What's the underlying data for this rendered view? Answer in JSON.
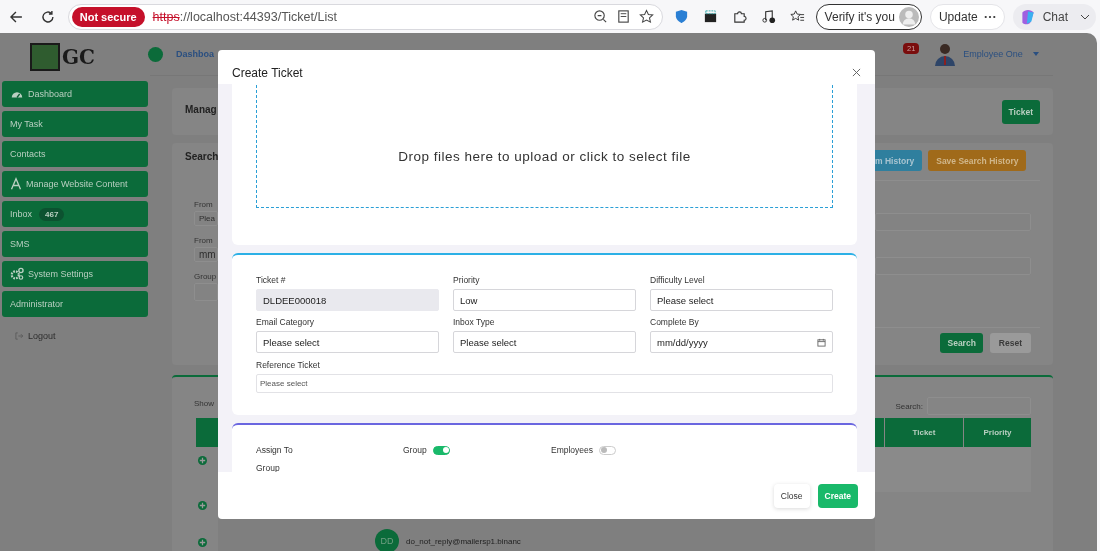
{
  "browser": {
    "security": "Not secure",
    "url_scheme": "https",
    "url_rest": "://localhost:44393/Ticket/List",
    "verify": "Verify it's you",
    "update": "Update",
    "chat": "Chat"
  },
  "sidebar": {
    "logo_text": "GC",
    "items": [
      {
        "label": "Dashboard"
      },
      {
        "label": "My Task"
      },
      {
        "label": "Contacts"
      },
      {
        "label": "Manage Website Content"
      },
      {
        "label": "Inbox",
        "badge": "467"
      },
      {
        "label": "SMS"
      },
      {
        "label": "System Settings"
      },
      {
        "label": "Administrator"
      }
    ],
    "logout": "Logout"
  },
  "header": {
    "breadcrumb": "Dashboa",
    "notifications": "21",
    "user": "Employee One"
  },
  "background": {
    "page_title": "Manag",
    "new_button": "Ticket",
    "search_title": "Search",
    "history_button": "m History",
    "save_history_button": "Save Search History",
    "filters": [
      {
        "label": "From",
        "placeholder": "Plea"
      },
      {
        "label": "From",
        "placeholder": "mm"
      },
      {
        "label": "Group"
      }
    ],
    "search_button": "Search",
    "reset_button": "Reset",
    "show_label": "Show",
    "table_search_label": "Search:",
    "columns": [
      "Ticket",
      "Priority"
    ],
    "row_email": "do_not_reply@mailersp1.binanc",
    "row_initials": "DD"
  },
  "modal": {
    "title": "Create Ticket",
    "dropzone_text": "Drop files here to upload or click to select file",
    "fields": [
      {
        "label": "Ticket #",
        "value": "DLDEE000018",
        "kind": "readonly"
      },
      {
        "label": "Priority",
        "value": "Low",
        "kind": "select"
      },
      {
        "label": "Difficulty Level",
        "value": "Please select",
        "kind": "select"
      },
      {
        "label": "Email Category",
        "value": "Please select",
        "kind": "select"
      },
      {
        "label": "Inbox Type",
        "value": "Please select",
        "kind": "select"
      },
      {
        "label": "Complete By",
        "value": "mm/dd/yyyy",
        "kind": "date"
      }
    ],
    "reference": {
      "label": "Reference Ticket",
      "placeholder": "Please select"
    },
    "assign_label": "Assign To",
    "toggles": [
      {
        "label": "Group",
        "on": true
      },
      {
        "label": "Employees",
        "on": false
      }
    ],
    "group_label": "Group",
    "buttons": [
      {
        "label": "Close",
        "kind": "secondary"
      },
      {
        "label": "Create",
        "kind": "primary"
      }
    ]
  }
}
